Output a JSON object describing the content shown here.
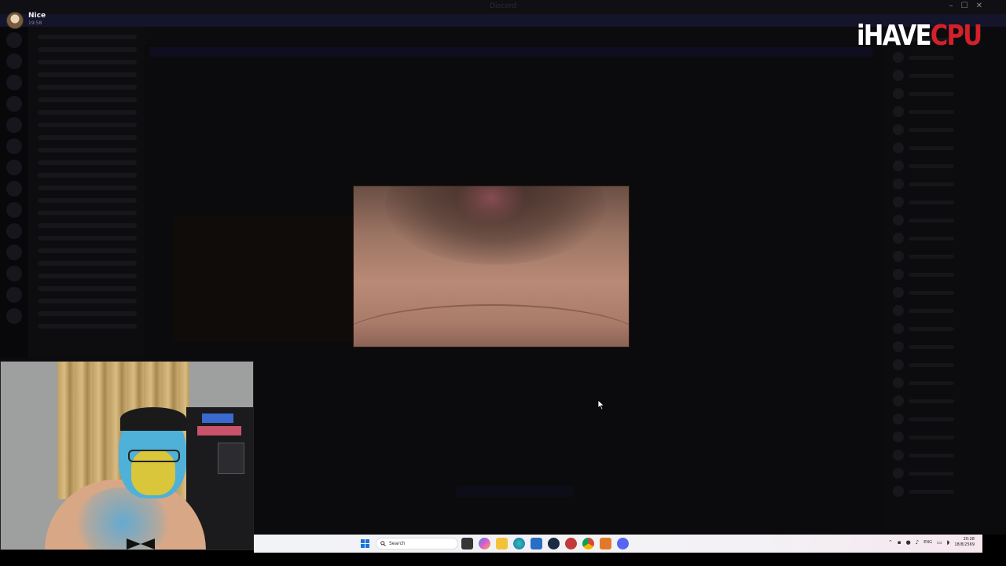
{
  "window": {
    "title": "Discord",
    "controls": [
      "–",
      "☐",
      "✕"
    ]
  },
  "notification": {
    "name": "Nice",
    "time": "19:58"
  },
  "logo": {
    "part_white": "iHAVE",
    "part_red": "CPU"
  },
  "taskbar": {
    "search_placeholder": "Search",
    "language": "ENG",
    "clock_time": "20:28",
    "clock_date": "18/8/2569",
    "pinned_icons": [
      "file-manager-icon",
      "copilot-icon",
      "file-explorer-icon",
      "edge-icon",
      "store-icon",
      "steam-icon",
      "app-red-icon",
      "chrome-icon",
      "app-orange-icon",
      "discord-icon"
    ]
  },
  "colors": {
    "logo_red": "#d3202a",
    "backdrop": "#000000",
    "taskbar": "#f2f3f6",
    "start_blue": "#1a73d9"
  }
}
